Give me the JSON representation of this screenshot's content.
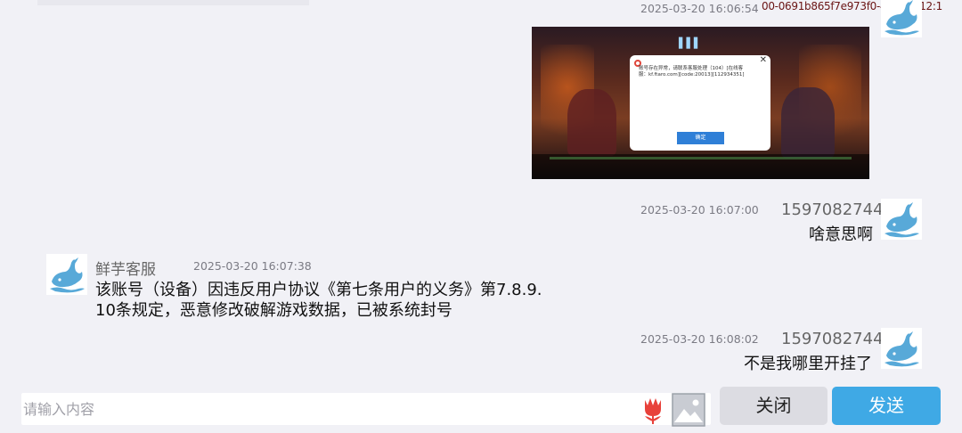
{
  "watermark": "00-0691b865f7e973f0-4920.3-12:1",
  "messages": [
    {
      "time": "2025-03-20 16:06:54",
      "type": "image"
    },
    {
      "time": "2025-03-20 16:07:00",
      "user": "1597082744",
      "text": "啥意思啊"
    },
    {
      "time": "2025-03-20 16:07:38",
      "user": "鲜芋客服",
      "text_line1": "该账号（设备）因违反用户协议《第七条用户的义务》第7.8.9.",
      "text_line2": "10条规定，恶意修改破解游戏数据，已被系统封号"
    },
    {
      "time": "2025-03-20 16:08:02",
      "user": "1597082744",
      "text": "不是我哪里开挂了"
    }
  ],
  "screenshot": {
    "dialog_text": "账号存在异常，请联系客服处理（104）[在线客\n服：kf.ftaro.com][code:20013][112934351]",
    "dialog_button": "确定",
    "dialog_close": "✕"
  },
  "composer": {
    "placeholder": "请输入内容",
    "close_label": "关闭",
    "send_label": "发送"
  },
  "colors": {
    "send": "#3fa9e5",
    "close": "#dcdce2",
    "background": "#f1f1f6"
  },
  "icons": [
    "whale-avatar-icon",
    "tulip-icon",
    "image-icon"
  ]
}
